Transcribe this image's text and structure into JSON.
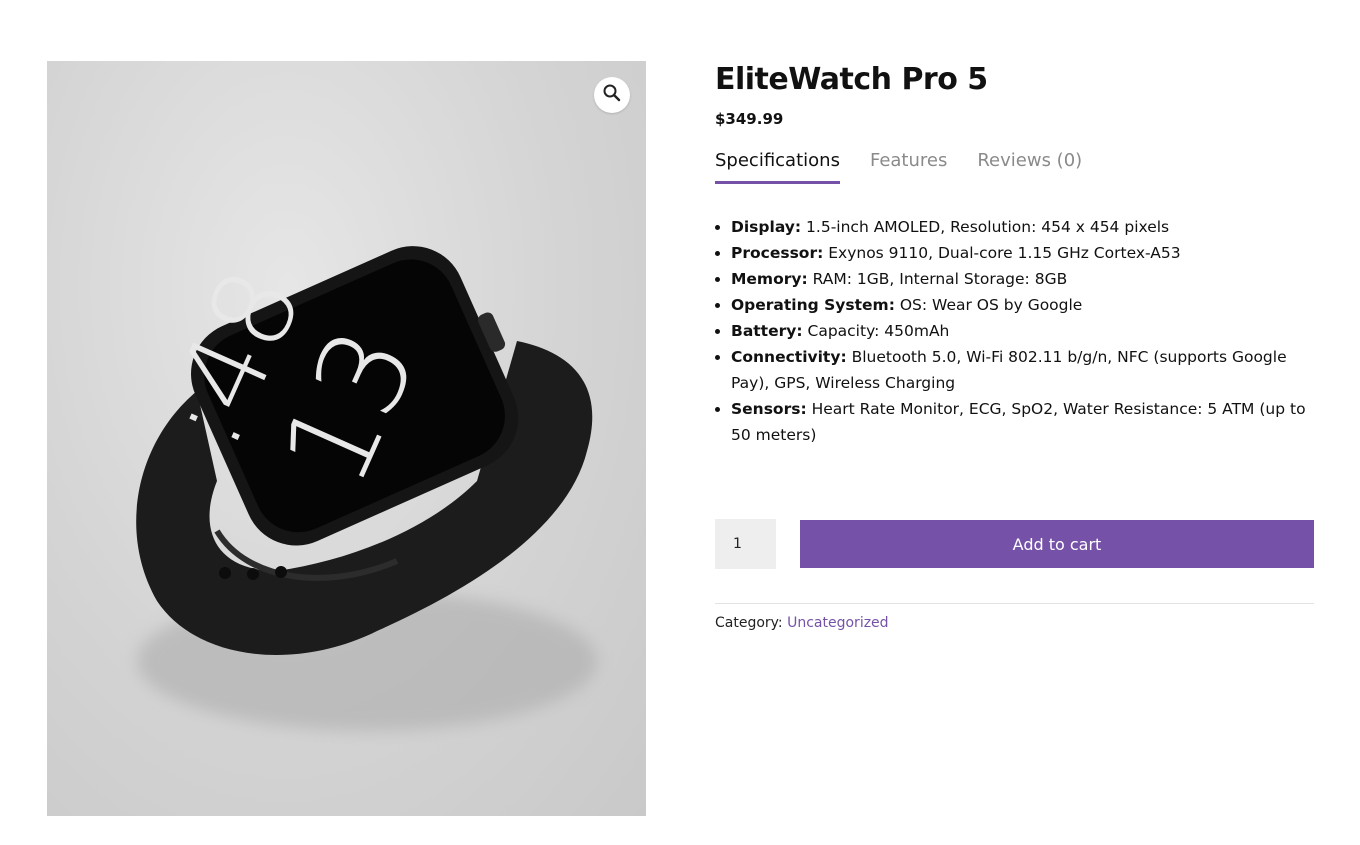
{
  "product": {
    "title": "EliteWatch Pro 5",
    "price": "$349.99",
    "image_watch_time": {
      "hour": "13",
      "minute": ":48"
    }
  },
  "gallery": {
    "zoom_icon": "magnifier-icon"
  },
  "tabs": [
    {
      "label": "Specifications",
      "active": true
    },
    {
      "label": "Features",
      "active": false
    },
    {
      "label": "Reviews (0)",
      "active": false
    }
  ],
  "specs": [
    {
      "label": "Display:",
      "value": "1.5-inch AMOLED, Resolution: 454 x 454 pixels"
    },
    {
      "label": "Processor:",
      "value": "Exynos 9110, Dual-core 1.15 GHz Cortex-A53"
    },
    {
      "label": "Memory:",
      "value": "RAM: 1GB, Internal Storage: 8GB"
    },
    {
      "label": "Operating System:",
      "value": "OS: Wear OS by Google"
    },
    {
      "label": "Battery:",
      "value": "Capacity: 450mAh"
    },
    {
      "label": "Connectivity:",
      "value": "Bluetooth 5.0, Wi-Fi 802.11 b/g/n, NFC (supports Google Pay), GPS, Wireless Charging"
    },
    {
      "label": "Sensors:",
      "value": "Heart Rate Monitor, ECG, SpO2, Water Resistance: 5 ATM (up to 50 meters)"
    }
  ],
  "cart": {
    "quantity": "1",
    "button_label": "Add to cart"
  },
  "meta": {
    "category_label": "Category:",
    "category_value": "Uncategorized"
  },
  "colors": {
    "accent": "#7552a7"
  }
}
